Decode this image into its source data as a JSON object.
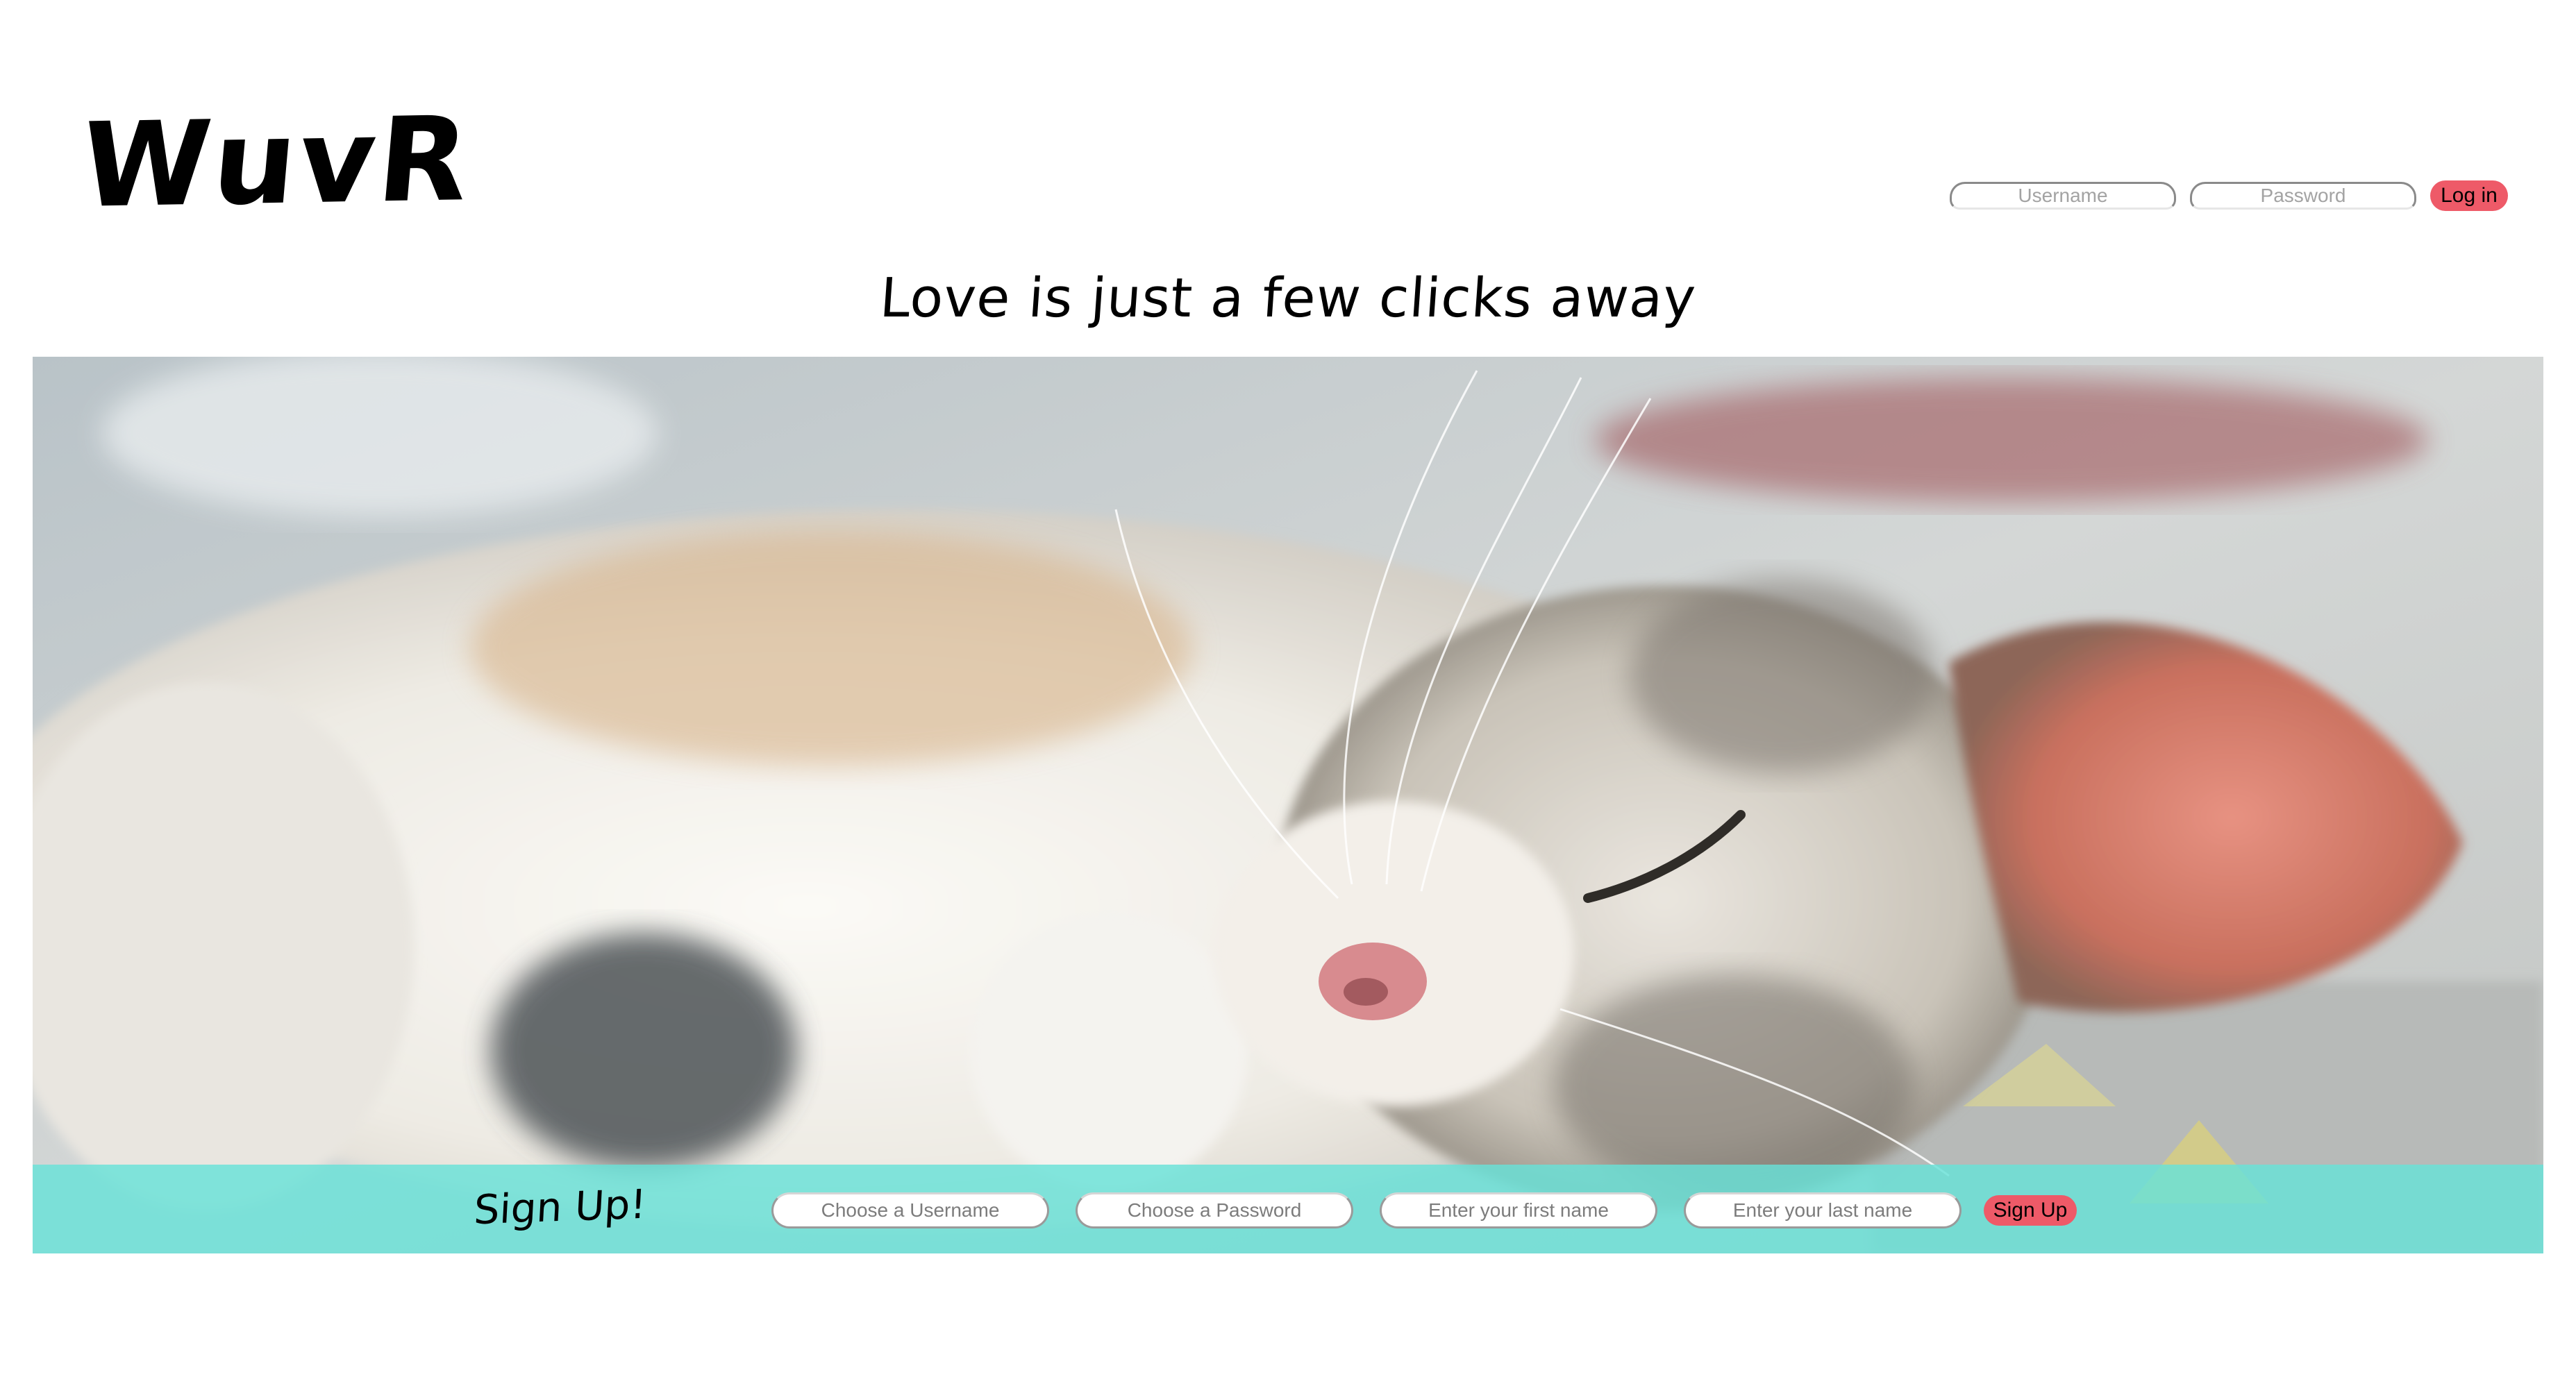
{
  "header": {
    "logo_text": "WuvR",
    "login": {
      "username_placeholder": "Username",
      "password_placeholder": "Password",
      "login_button": "Log in"
    }
  },
  "tagline": "Love is just a few clicks away",
  "hero": {
    "image_subject": "sleeping kitten"
  },
  "signup": {
    "title": "Sign Up!",
    "username_placeholder": "Choose a Username",
    "password_placeholder": "Choose a Password",
    "first_name_placeholder": "Enter your first name",
    "last_name_placeholder": "Enter your last name",
    "signup_button": "Sign Up"
  },
  "colors": {
    "accent_button": "#ee5a68",
    "signup_bar": "#68e2d8"
  }
}
